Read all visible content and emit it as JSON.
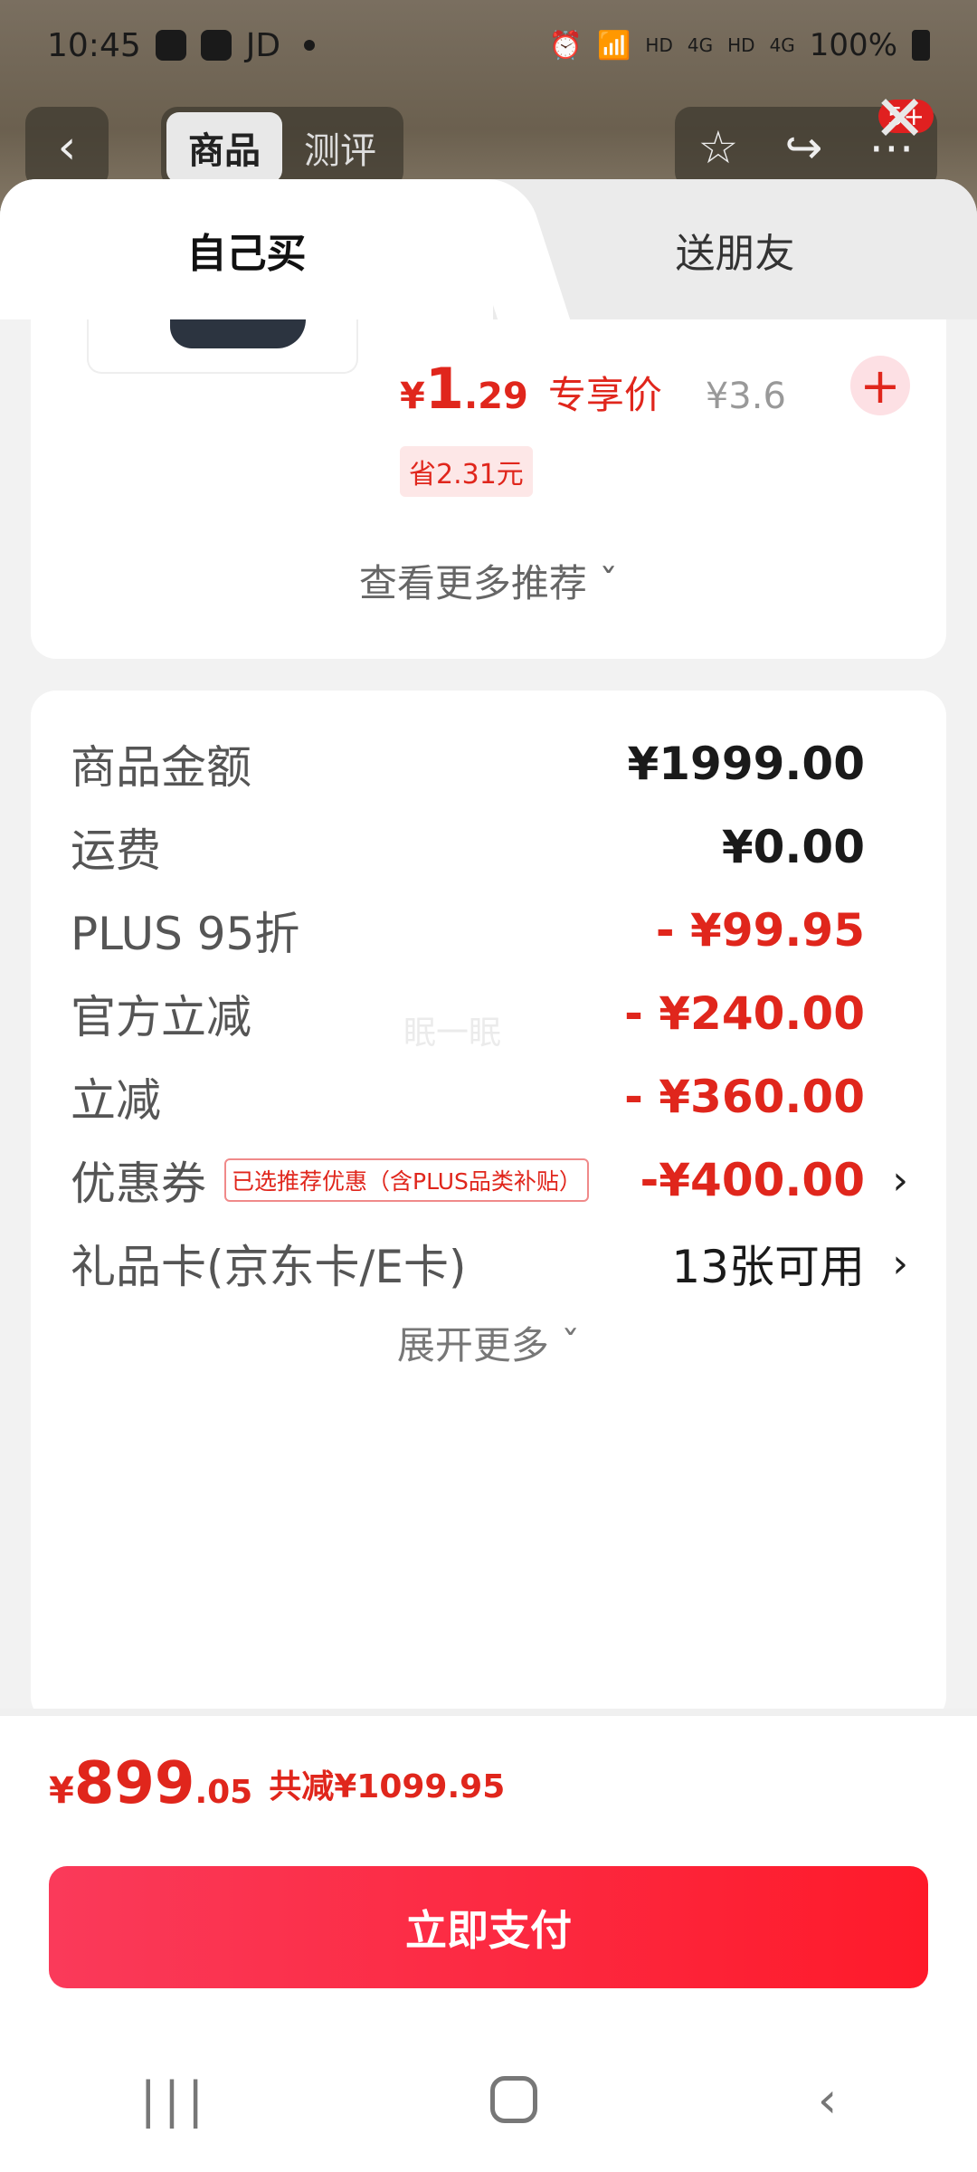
{
  "status_bar": {
    "time": "10:45",
    "app_label": "JD",
    "network_left": "HD",
    "network_right": "HD",
    "signal_type": "4G",
    "battery": "100%"
  },
  "top_nav": {
    "tabs": [
      "商品",
      "测评"
    ],
    "badge": "5+",
    "icons": [
      "back-icon",
      "star-icon",
      "share-icon",
      "more-icon",
      "close-icon"
    ]
  },
  "sheet_tabs": {
    "active": "自己买",
    "other": "送朋友"
  },
  "recommend": {
    "price_yen": "¥",
    "price_int": "1",
    "price_dec": ".29",
    "exclusive_label": "专享价",
    "original_price": "¥3.6",
    "save_tag": "省2.31元",
    "more_label": "查看更多推荐 ˇ"
  },
  "summary": {
    "rows": [
      {
        "label": "商品金额",
        "value": "¥1999.00"
      },
      {
        "label": "运费",
        "value": "¥0.00"
      },
      {
        "label": "PLUS 95折",
        "value": "- ¥99.95"
      },
      {
        "label": "官方立减",
        "value": "- ¥240.00"
      },
      {
        "label": "立减",
        "value": "- ¥360.00"
      },
      {
        "label": "优惠券",
        "tag": "已选推荐优惠（含PLUS品类补贴）",
        "value": "-¥400.00"
      },
      {
        "label": "礼品卡(京东卡/E卡)",
        "value": "13张可用"
      }
    ],
    "watermark": "眠一眠",
    "expand_label": "展开更多 ˇ"
  },
  "total": {
    "yen": "¥",
    "int": "899",
    "dec": ".05",
    "saved": "共减¥1099.95"
  },
  "pay_button": "立即支付",
  "colors": {
    "accent_red": "#e0261c",
    "pay_gradient_start": "#fa3a5a",
    "pay_gradient_end": "#fe1a2a"
  }
}
